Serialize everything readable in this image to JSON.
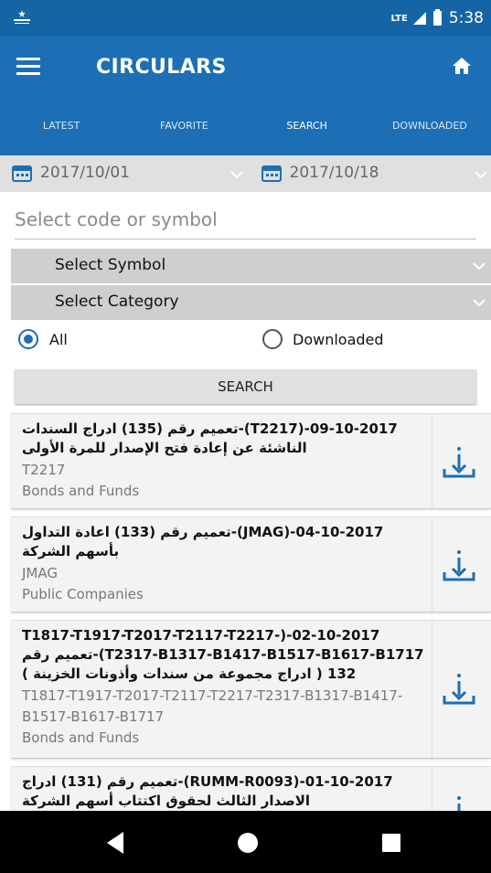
{
  "status_bar": {
    "network": "LTE",
    "time": "5:38"
  },
  "app_bar": {
    "title": "CIRCULARS",
    "menu_icon": "hamburger-menu-icon",
    "home_icon": "home-icon"
  },
  "tabs": [
    {
      "label": "LATEST",
      "active": false
    },
    {
      "label": "FAVORITE",
      "active": false
    },
    {
      "label": "SEARCH",
      "active": true
    },
    {
      "label": "DOWNLOADED",
      "active": false
    }
  ],
  "filters": {
    "date_from": "2017/10/01",
    "date_to": "2017/10/18",
    "code_placeholder": "Select code or symbol",
    "symbol_select": "Select Symbol",
    "category_select": "Select Category",
    "radio_all": "All",
    "radio_downloaded": "Downloaded",
    "selected_radio": "All",
    "search_button": "SEARCH"
  },
  "results": [
    {
      "title": "09-10-2017-(T2217)-تعميم رقم (135) ادراج السندات الناشئة عن إعادة فتح الإصدار للمرة الأولى",
      "code": "T2217",
      "category": "Bonds and Funds"
    },
    {
      "title": "04-10-2017-(JMAG)-تعميم رقم (133) اعادة التداول بأسهم الشركة",
      "code": "JMAG",
      "category": "Public Companies"
    },
    {
      "title": "02-10-2017-(T1817-T1917-T2017-T2117-T2217-T2317-B1317-B1417-B1517-B1617-B1717)-تعميم رقم 132 ( ادراج مجموعة من سندات وأذونات الخزينة )",
      "code": "T1817-T1917-T2017-T2117-T2217-T2317-B1317-B1417-B1517-B1617-B1717",
      "category": "Bonds and Funds"
    },
    {
      "title": "01-10-2017-(RUMM-R0093)-تعميم رقم (131) ادراج الاصدار الثالث لحقوق اكتتاب أسهم الشركة",
      "code": "",
      "category": ""
    }
  ],
  "colors": {
    "primary": "#1c6fb5",
    "status_bar": "#1565a6",
    "accent": "#1c6fb5"
  }
}
